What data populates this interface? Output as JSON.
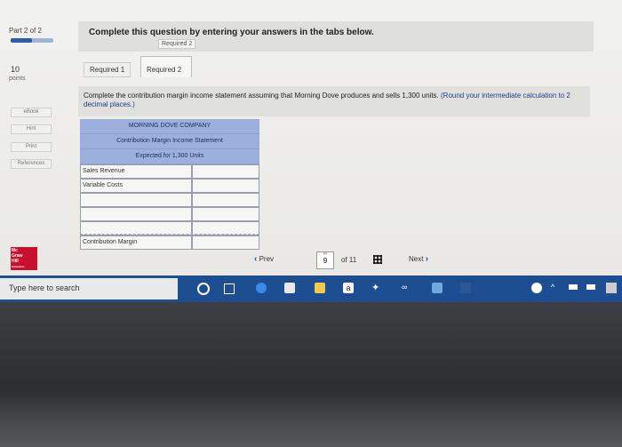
{
  "header": {
    "part": "Part 2 of 2",
    "title": "Complete this question by entering your answers in the tabs below.",
    "tag": "Required 2"
  },
  "points": {
    "value": "10",
    "label": "points"
  },
  "sidebar": {
    "items": [
      "eBook",
      "Hint",
      "Print",
      "References"
    ]
  },
  "tabs": [
    {
      "label": "Required 1"
    },
    {
      "label": "Required 2"
    }
  ],
  "instructions": {
    "main": "Complete the contribution margin income statement assuming that Morning Dove produces and sells 1,300 units.",
    "note": "(Round your intermediate calculation to 2 decimal places.)"
  },
  "statement": {
    "company": "MORNING DOVE COMPANY",
    "title": "Contribution Margin Income Statement",
    "subtitle": "Expected for 1,300 Units",
    "rows": [
      {
        "label": "Sales Revenue",
        "value": ""
      },
      {
        "label": "Variable Costs",
        "value": ""
      },
      {
        "label": "",
        "value": ""
      },
      {
        "label": "",
        "value": ""
      },
      {
        "label": "",
        "value": ""
      },
      {
        "label": "Contribution Margin",
        "value": ""
      }
    ]
  },
  "logo": {
    "line1": "Mc",
    "line2": "Graw",
    "line3": "Hill",
    "line4": "Education"
  },
  "pagination": {
    "prev": "Prev",
    "current": "9",
    "of": "of 11",
    "next": "Next"
  },
  "taskbar": {
    "search_placeholder": "Type here to search"
  },
  "colors": {
    "accent": "#1e4fae",
    "header_fill": "#9db0dd",
    "taskbar": "#1c4e91",
    "logo": "#c8102e"
  }
}
